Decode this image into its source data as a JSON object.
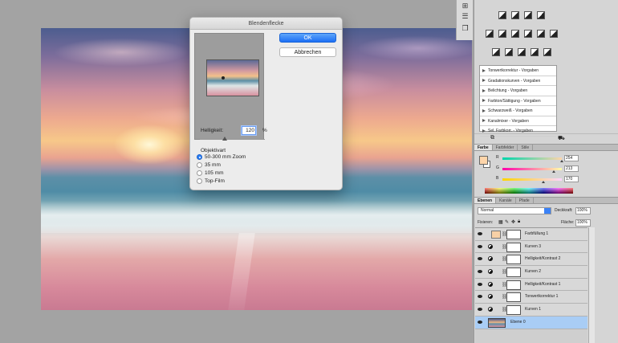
{
  "dialog": {
    "title": "Blendenflecke",
    "ok_label": "OK",
    "cancel_label": "Abbrechen",
    "brightness_label": "Helligkeit:",
    "brightness_value": "120",
    "brightness_unit": "%",
    "lens_label": "Objektivart",
    "lens_options": [
      "50-300 mm Zoom",
      "35 mm",
      "105 mm",
      "Top-Film"
    ],
    "lens_selected": "50-300 mm Zoom"
  },
  "adjustments": {
    "presets": [
      "Tonwertkorrektur - Vorgaben",
      "Gradationskurven - Vorgaben",
      "Belichtung - Vorgaben",
      "Farbton/Sättigung - Vorgaben",
      "Schwarzweiß - Vorgaben",
      "Kanalmixer - Vorgaben",
      "Sel. Farbkorr. - Vorgaben"
    ]
  },
  "color_panel": {
    "tabs": [
      "Farbe",
      "Farbfelder",
      "Stile"
    ],
    "active_tab": "Farbe",
    "channels": [
      {
        "letter": "R",
        "value": "254"
      },
      {
        "letter": "G",
        "value": "213"
      },
      {
        "letter": "B",
        "value": "170"
      }
    ],
    "foreground_color": "#fed5aa"
  },
  "layers_panel": {
    "tabs": [
      "Ebenen",
      "Kanäle",
      "Pfade"
    ],
    "active_tab": "Ebenen",
    "blend_mode": "Normal",
    "opacity_label": "Deckkraft:",
    "opacity_value": "100%",
    "lock_label": "Fixieren:",
    "fill_label": "Fläche:",
    "fill_value": "100%",
    "layers": [
      {
        "name": "Farbfüllung 1",
        "kind": "fill",
        "selected": false
      },
      {
        "name": "Kurven 3",
        "kind": "adjustment",
        "selected": false
      },
      {
        "name": "Helligkeit/Kontrast 2",
        "kind": "adjustment",
        "selected": false
      },
      {
        "name": "Kurven 2",
        "kind": "adjustment",
        "selected": false
      },
      {
        "name": "Helligkeit/Kontrast 1",
        "kind": "adjustment",
        "selected": false
      },
      {
        "name": "Tonwertkorrektur 1",
        "kind": "adjustment",
        "selected": false
      },
      {
        "name": "Kurven 1",
        "kind": "adjustment",
        "selected": false
      },
      {
        "name": "Ebene 0",
        "kind": "image",
        "selected": true
      }
    ]
  }
}
